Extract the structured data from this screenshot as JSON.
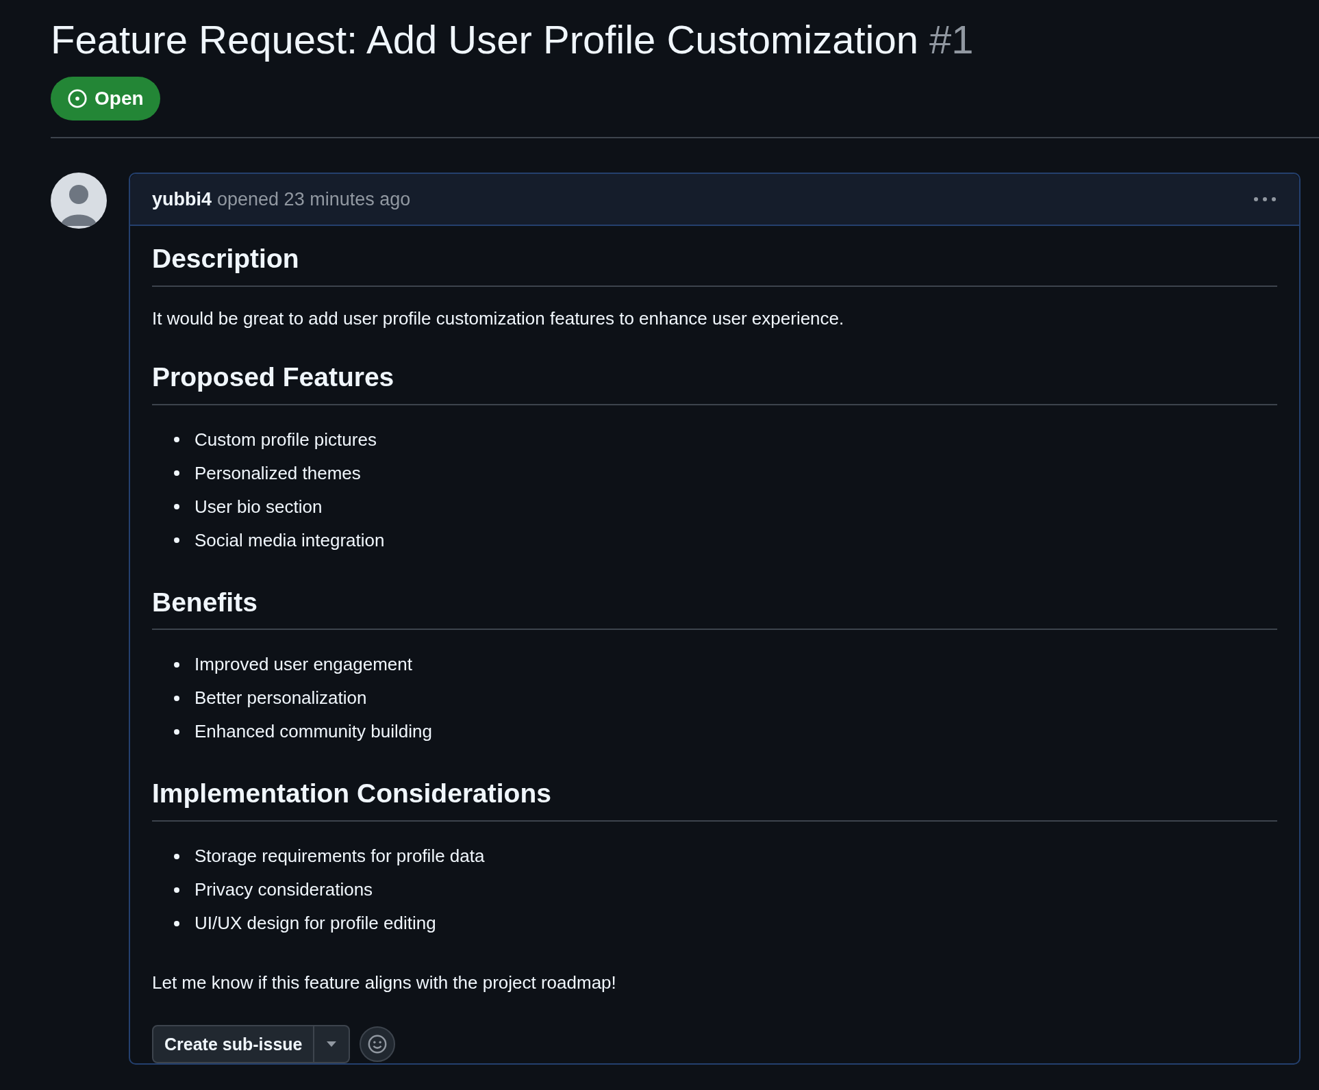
{
  "issue": {
    "title": "Feature Request: Add User Profile Customization",
    "number": "#1",
    "state": {
      "kind": "open",
      "label": "Open"
    }
  },
  "comment": {
    "author": "yubbi4",
    "meta": "opened 23 minutes ago",
    "body": [
      {
        "kind": "heading",
        "text": "Description"
      },
      {
        "kind": "paragraph",
        "text": "It would be great to add user profile customization features to enhance user experience."
      },
      {
        "kind": "heading",
        "text": "Proposed Features"
      },
      {
        "kind": "list",
        "items": [
          "Custom profile pictures",
          "Personalized themes",
          "User bio section",
          "Social media integration"
        ]
      },
      {
        "kind": "heading",
        "text": "Benefits"
      },
      {
        "kind": "list",
        "items": [
          "Improved user engagement",
          "Better personalization",
          "Enhanced community building"
        ]
      },
      {
        "kind": "heading",
        "text": "Implementation Considerations"
      },
      {
        "kind": "list",
        "items": [
          "Storage requirements for profile data",
          "Privacy considerations",
          "UI/UX design for profile editing"
        ]
      },
      {
        "kind": "paragraph",
        "text": "Let me know if this feature aligns with the project roadmap!"
      }
    ],
    "actions": {
      "button": "Create sub-issue"
    }
  }
}
